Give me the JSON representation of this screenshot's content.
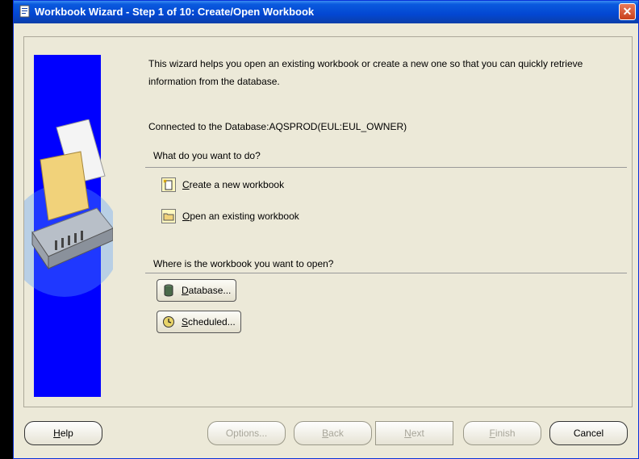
{
  "window": {
    "title": "Workbook Wizard - Step 1 of 10: Create/Open Workbook",
    "close_glyph": "✕"
  },
  "intro": {
    "text": "This wizard helps you open an existing workbook or create a new one so that you can quickly retrieve information from the database."
  },
  "connection": {
    "text": "Connected to the Database:AQSPROD(EUL:EUL_OWNER)"
  },
  "what_section": {
    "label": "What do you want to do?",
    "actions": [
      {
        "mnemonic": "C",
        "rest": "reate a new workbook",
        "icon": "new-workbook-icon"
      },
      {
        "mnemonic": "O",
        "rest": "pen an existing workbook",
        "icon": "open-folder-icon"
      }
    ]
  },
  "where_section": {
    "label": "Where is the workbook you want to open?",
    "buttons": [
      {
        "mnemonic": "D",
        "rest": "atabase...",
        "icon": "database-icon"
      },
      {
        "mnemonic": "S",
        "rest": "cheduled...",
        "icon": "clock-icon"
      }
    ]
  },
  "footer": {
    "help": {
      "mnemonic": "H",
      "rest": "elp"
    },
    "options": "Options...",
    "back": {
      "mnemonic": "B",
      "rest": "ack"
    },
    "next": {
      "mnemonic": "N",
      "rest": "ext"
    },
    "finish": {
      "mnemonic": "F",
      "rest": "inish"
    },
    "cancel": "Cancel"
  }
}
